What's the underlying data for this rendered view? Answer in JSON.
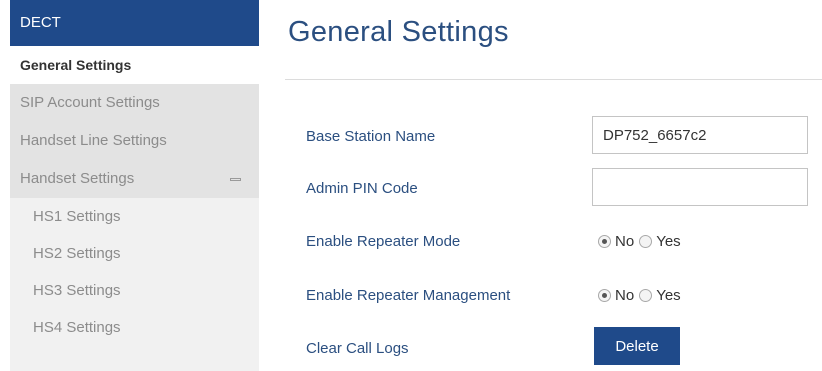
{
  "sidebar": {
    "header": "DECT",
    "items": [
      {
        "label": "General Settings"
      },
      {
        "label": "SIP Account Settings"
      },
      {
        "label": "Handset Line Settings"
      },
      {
        "label": "Handset Settings"
      },
      {
        "label": "HS1 Settings"
      },
      {
        "label": "HS2 Settings"
      },
      {
        "label": "HS3 Settings"
      },
      {
        "label": "HS4 Settings"
      }
    ]
  },
  "main": {
    "title": "General Settings",
    "base_station_name": {
      "label": "Base Station Name",
      "value": "DP752_6657c2"
    },
    "admin_pin": {
      "label": "Admin PIN Code",
      "value": ""
    },
    "repeater_mode": {
      "label": "Enable Repeater Mode",
      "options": [
        "No",
        "Yes"
      ],
      "selected": "No"
    },
    "repeater_management": {
      "label": "Enable Repeater Management",
      "options": [
        "No",
        "Yes"
      ],
      "selected": "No"
    },
    "clear_call_logs": {
      "label": "Clear Call Logs",
      "button": "Delete"
    }
  },
  "colors": {
    "accent": "#1f4a8a",
    "title": "#2b4f80"
  }
}
